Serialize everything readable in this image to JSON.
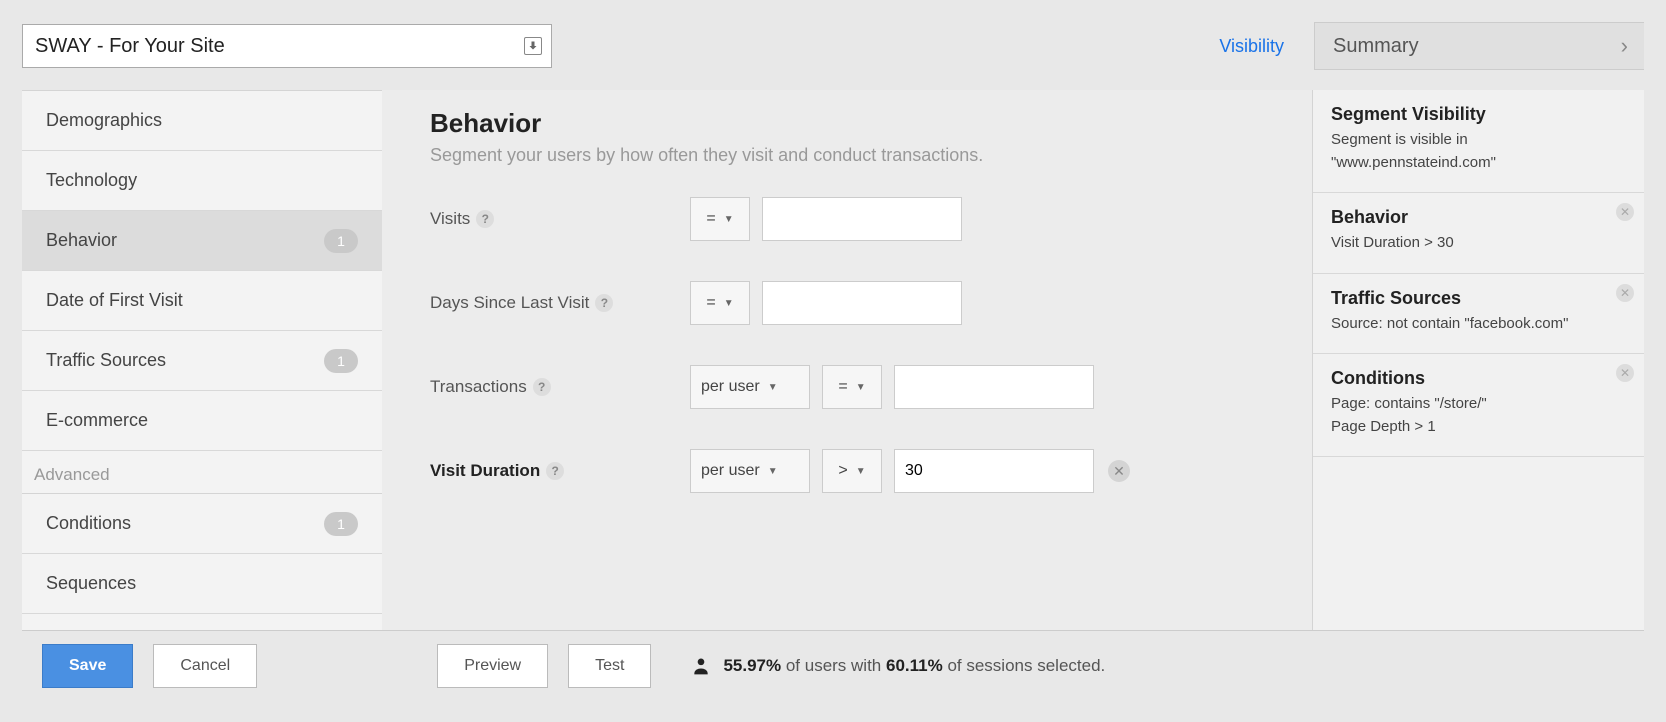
{
  "header": {
    "segment_name_value": "SWAY - For Your Site",
    "visibility_label": "Visibility",
    "summary_label": "Summary"
  },
  "sidebar": {
    "items": [
      {
        "label": "Demographics",
        "badge": null,
        "active": false
      },
      {
        "label": "Technology",
        "badge": null,
        "active": false
      },
      {
        "label": "Behavior",
        "badge": "1",
        "active": true
      },
      {
        "label": "Date of First Visit",
        "badge": null,
        "active": false
      },
      {
        "label": "Traffic Sources",
        "badge": "1",
        "active": false
      },
      {
        "label": "E-commerce",
        "badge": null,
        "active": false
      }
    ],
    "advanced_group_label": "Advanced",
    "advanced_items": [
      {
        "label": "Conditions",
        "badge": "1",
        "active": false
      },
      {
        "label": "Sequences",
        "badge": null,
        "active": false
      }
    ]
  },
  "main": {
    "title": "Behavior",
    "subtitle": "Segment your users by how often they visit and conduct transactions.",
    "rows": {
      "visits": {
        "label": "Visits",
        "op": "=",
        "value": ""
      },
      "days_since": {
        "label": "Days Since Last Visit",
        "op": "=",
        "value": ""
      },
      "transactions": {
        "label": "Transactions",
        "scope": "per user",
        "op": "=",
        "value": ""
      },
      "visit_duration": {
        "label": "Visit Duration",
        "scope": "per user",
        "op": ">",
        "value": "30"
      }
    }
  },
  "summary": {
    "visibility": {
      "title": "Segment Visibility",
      "line1": "Segment is visible in",
      "line2": "\"www.pennstateind.com\""
    },
    "behavior": {
      "title": "Behavior",
      "line": "Visit Duration > 30"
    },
    "traffic": {
      "title": "Traffic Sources",
      "line": "Source: not contain \"facebook.com\""
    },
    "conditions": {
      "title": "Conditions",
      "line1": "Page: contains \"/store/\"",
      "line2": "Page Depth > 1"
    }
  },
  "footer": {
    "save": "Save",
    "cancel": "Cancel",
    "preview": "Preview",
    "test": "Test",
    "stats_pct_users": "55.97%",
    "stats_mid": " of users with ",
    "stats_pct_sessions": "60.11%",
    "stats_tail": " of sessions selected."
  }
}
